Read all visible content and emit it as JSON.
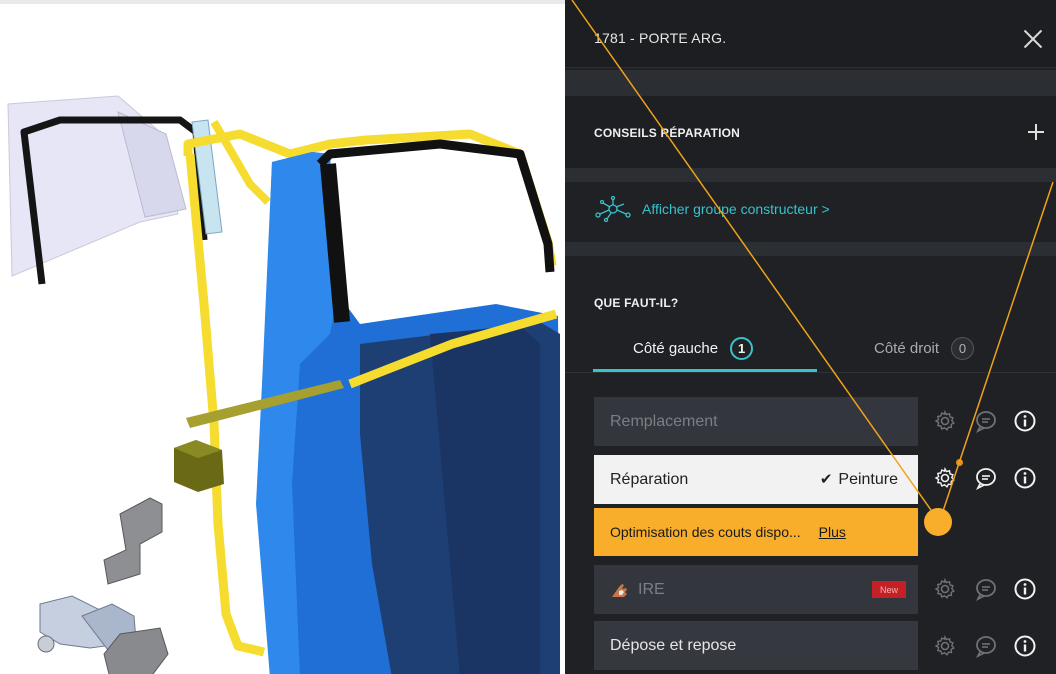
{
  "header": {
    "title": "1781 - PORTE ARG.",
    "close_icon": "close-icon"
  },
  "conseils": {
    "title": "CONSEILS RÉPARATION",
    "expand_icon": "plus-icon"
  },
  "group_link": {
    "label": "Afficher groupe constructeur >",
    "icon": "network-icon",
    "color": "#37c2cc"
  },
  "question": {
    "title": "QUE FAUT-IL?",
    "tabs": [
      {
        "label": "Côté gauche",
        "count": "1",
        "active": true
      },
      {
        "label": "Côté droit",
        "count": "0",
        "active": false
      }
    ]
  },
  "operations": {
    "remplacement": {
      "label": "Remplacement"
    },
    "reparation": {
      "label": "Réparation",
      "extra": "Peinture",
      "check_icon": "check-icon"
    },
    "optimisation": {
      "label": "Optimisation des couts dispo...",
      "link": "Plus"
    },
    "ire": {
      "label": "IRE",
      "tag": "New",
      "icon": "hand-icon"
    },
    "depose": {
      "label": "Dépose et repose"
    }
  },
  "colors": {
    "accent": "#37c2cc",
    "warning": "#f8ad2b",
    "panel": "#1f2125",
    "notification": "#f08c1c",
    "new_tag": "#c42126"
  }
}
